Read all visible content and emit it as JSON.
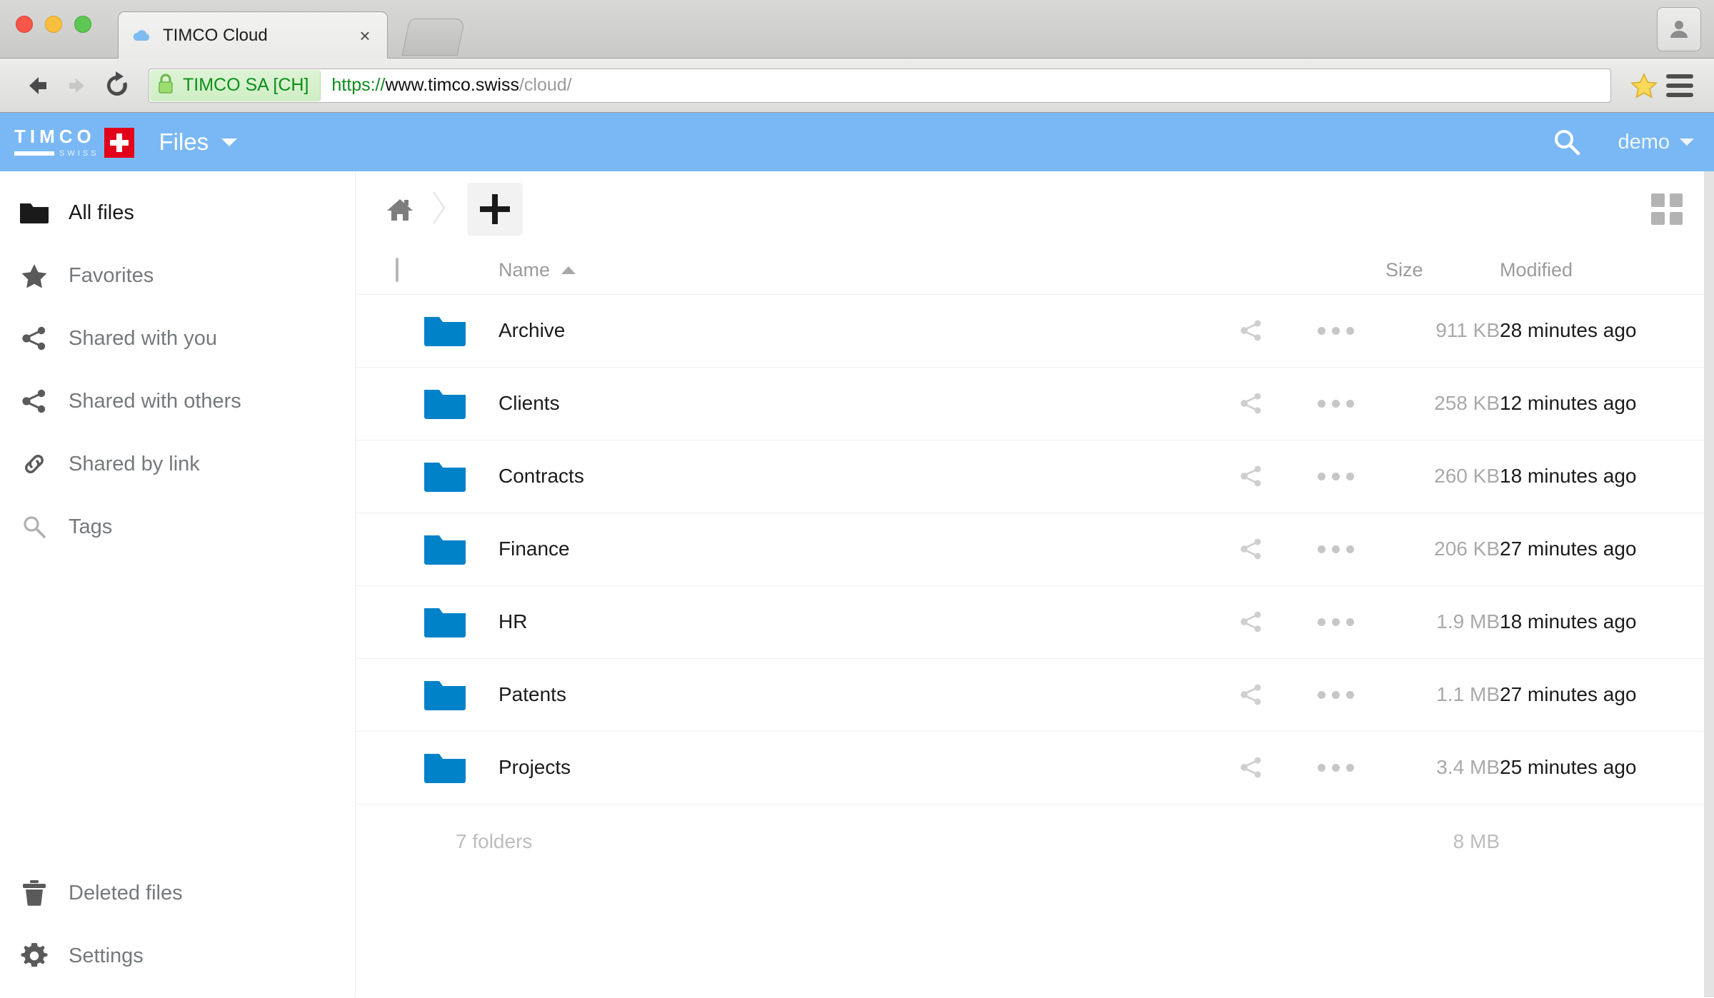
{
  "browser": {
    "tab": {
      "title": "TIMCO Cloud",
      "favicon": "cloud-icon",
      "close": "×"
    },
    "nav": {
      "back": "back-icon",
      "forward": "forward-icon",
      "reload": "reload-icon"
    },
    "omnibox": {
      "ev_certificate": "TIMCO SA [CH]",
      "lock": "lock-icon",
      "url_scheme": "https://",
      "url_host": "www.timco.swiss",
      "url_path": "/cloud/",
      "url_full": "https://www.timco.swiss/cloud/"
    },
    "star": "bookmark-star-icon",
    "menu": "hamburger-menu-icon",
    "profile": "profile-avatar-icon"
  },
  "appheader": {
    "logo_word": "TIMCO",
    "logo_sub": "SWISS",
    "title": "Files",
    "search": "search-icon",
    "user": "demo"
  },
  "sidebar": {
    "items": [
      {
        "label": "All files",
        "icon": "folder-icon",
        "active": true
      },
      {
        "label": "Favorites",
        "icon": "star-icon",
        "active": false
      },
      {
        "label": "Shared with you",
        "icon": "share-icon",
        "active": false
      },
      {
        "label": "Shared with others",
        "icon": "share-icon",
        "active": false
      },
      {
        "label": "Shared by link",
        "icon": "link-icon",
        "active": false
      },
      {
        "label": "Tags",
        "icon": "tag-search-icon",
        "active": false
      }
    ],
    "bottom": [
      {
        "label": "Deleted files",
        "icon": "trash-icon"
      },
      {
        "label": "Settings",
        "icon": "gear-icon"
      }
    ]
  },
  "toolbar": {
    "home": "home-icon",
    "separator": "chevron-right-icon",
    "new_button": "plus-icon",
    "view_toggle": "grid-view-icon"
  },
  "filetable": {
    "headers": {
      "select_all": "select-all-checkbox",
      "name": "Name",
      "sort": "ascending",
      "size": "Size",
      "modified": "Modified"
    },
    "rows": [
      {
        "name": "Archive",
        "icon": "folder-icon",
        "size": "911 KB",
        "modified": "28 minutes ago",
        "share": "share-icon",
        "menu": "more-actions-icon"
      },
      {
        "name": "Clients",
        "icon": "folder-icon",
        "size": "258 KB",
        "modified": "12 minutes ago",
        "share": "share-icon",
        "menu": "more-actions-icon"
      },
      {
        "name": "Contracts",
        "icon": "folder-icon",
        "size": "260 KB",
        "modified": "18 minutes ago",
        "share": "share-icon",
        "menu": "more-actions-icon"
      },
      {
        "name": "Finance",
        "icon": "folder-icon",
        "size": "206 KB",
        "modified": "27 minutes ago",
        "share": "share-icon",
        "menu": "more-actions-icon"
      },
      {
        "name": "HR",
        "icon": "folder-icon",
        "size": "1.9 MB",
        "modified": "18 minutes ago",
        "share": "share-icon",
        "menu": "more-actions-icon"
      },
      {
        "name": "Patents",
        "icon": "folder-icon",
        "size": "1.1 MB",
        "modified": "27 minutes ago",
        "share": "share-icon",
        "menu": "more-actions-icon"
      },
      {
        "name": "Projects",
        "icon": "folder-icon",
        "size": "3.4 MB",
        "modified": "25 minutes ago",
        "share": "share-icon",
        "menu": "more-actions-icon"
      }
    ],
    "summary": {
      "count": "7 folders",
      "total_size": "8 MB"
    }
  },
  "colors": {
    "app_header_blue": "#7ab8f5",
    "folder_blue": "#0082c9",
    "ev_green": "#0a8f18",
    "swiss_red": "#e2001a"
  }
}
